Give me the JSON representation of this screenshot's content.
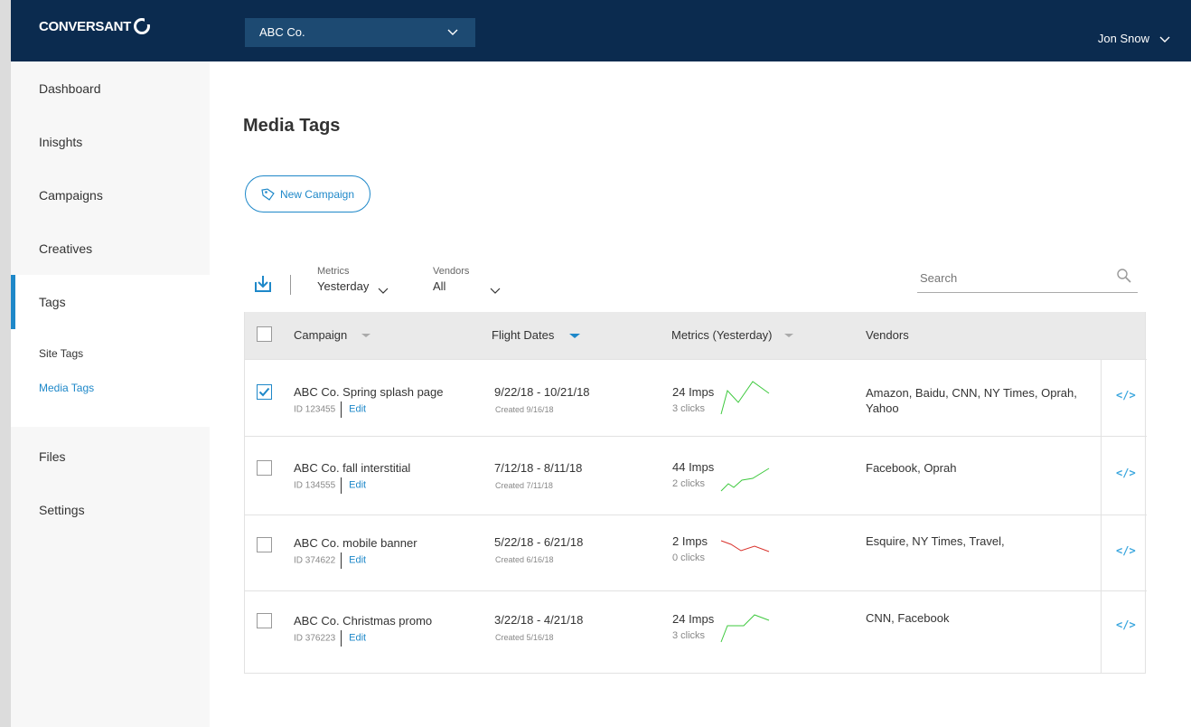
{
  "brand": {
    "name": "CONVERSANT"
  },
  "account_selector": {
    "value": "ABC Co."
  },
  "user": {
    "name": "Jon Snow"
  },
  "nav": {
    "items": [
      "Dashboard",
      "Inisghts",
      "Campaigns",
      "Creatives",
      "Tags"
    ],
    "sub_items": [
      "Site Tags",
      "Media Tags"
    ],
    "items_after": [
      "Files",
      "Settings"
    ]
  },
  "page": {
    "title": "Media Tags",
    "new_button": "New Campaign"
  },
  "toolbar": {
    "metrics_label": "Metrics",
    "metrics_value": "Yesterday",
    "vendors_label": "Vendors",
    "vendors_value": "All",
    "search_placeholder": "Search"
  },
  "table": {
    "headers": [
      "Campaign",
      "Flight Dates",
      "Metrics (Yesterday)",
      "Vendors"
    ],
    "rows": [
      {
        "name": "ABC Co. Spring splash page",
        "id": "ID 123455",
        "edit": "Edit",
        "dates": "9/22/18 - 10/21/18",
        "created": "Created 9/16/18",
        "imps": "24 Imps",
        "clicks": "3 clicks",
        "vendors": "Amazon, Baidu, CNN, NY Times, Oprah, Yahoo",
        "checked": true,
        "trend_color": "#3ec93e"
      },
      {
        "name": "ABC Co. fall interstitial",
        "id": "ID 134555",
        "edit": "Edit",
        "dates": "7/12/18 - 8/11/18",
        "created": "Created 7/11/18",
        "imps": "44 Imps",
        "clicks": "2 clicks",
        "vendors": "Facebook, Oprah",
        "checked": false,
        "trend_color": "#3ec93e"
      },
      {
        "name": "ABC Co. mobile banner",
        "id": "ID 374622",
        "edit": "Edit",
        "dates": "5/22/18 - 6/21/18",
        "created": "Created 6/16/18",
        "imps": "2 Imps",
        "clicks": "0 clicks",
        "vendors": "Esquire, NY Times, Travel,",
        "checked": false,
        "trend_color": "#d9312b"
      },
      {
        "name": "ABC Co. Christmas promo",
        "id": "ID 376223",
        "edit": "Edit",
        "dates": "3/22/18 - 4/21/18",
        "created": "Created 5/16/18",
        "imps": "24 Imps",
        "clicks": "3 clicks",
        "vendors": "CNN, Facebook",
        "checked": false,
        "trend_color": "#3ec93e"
      }
    ]
  },
  "colors": {
    "topbar": "#0b2b4f",
    "accent": "#1e88c9",
    "positive": "#3ec93e",
    "negative": "#d9312b"
  }
}
